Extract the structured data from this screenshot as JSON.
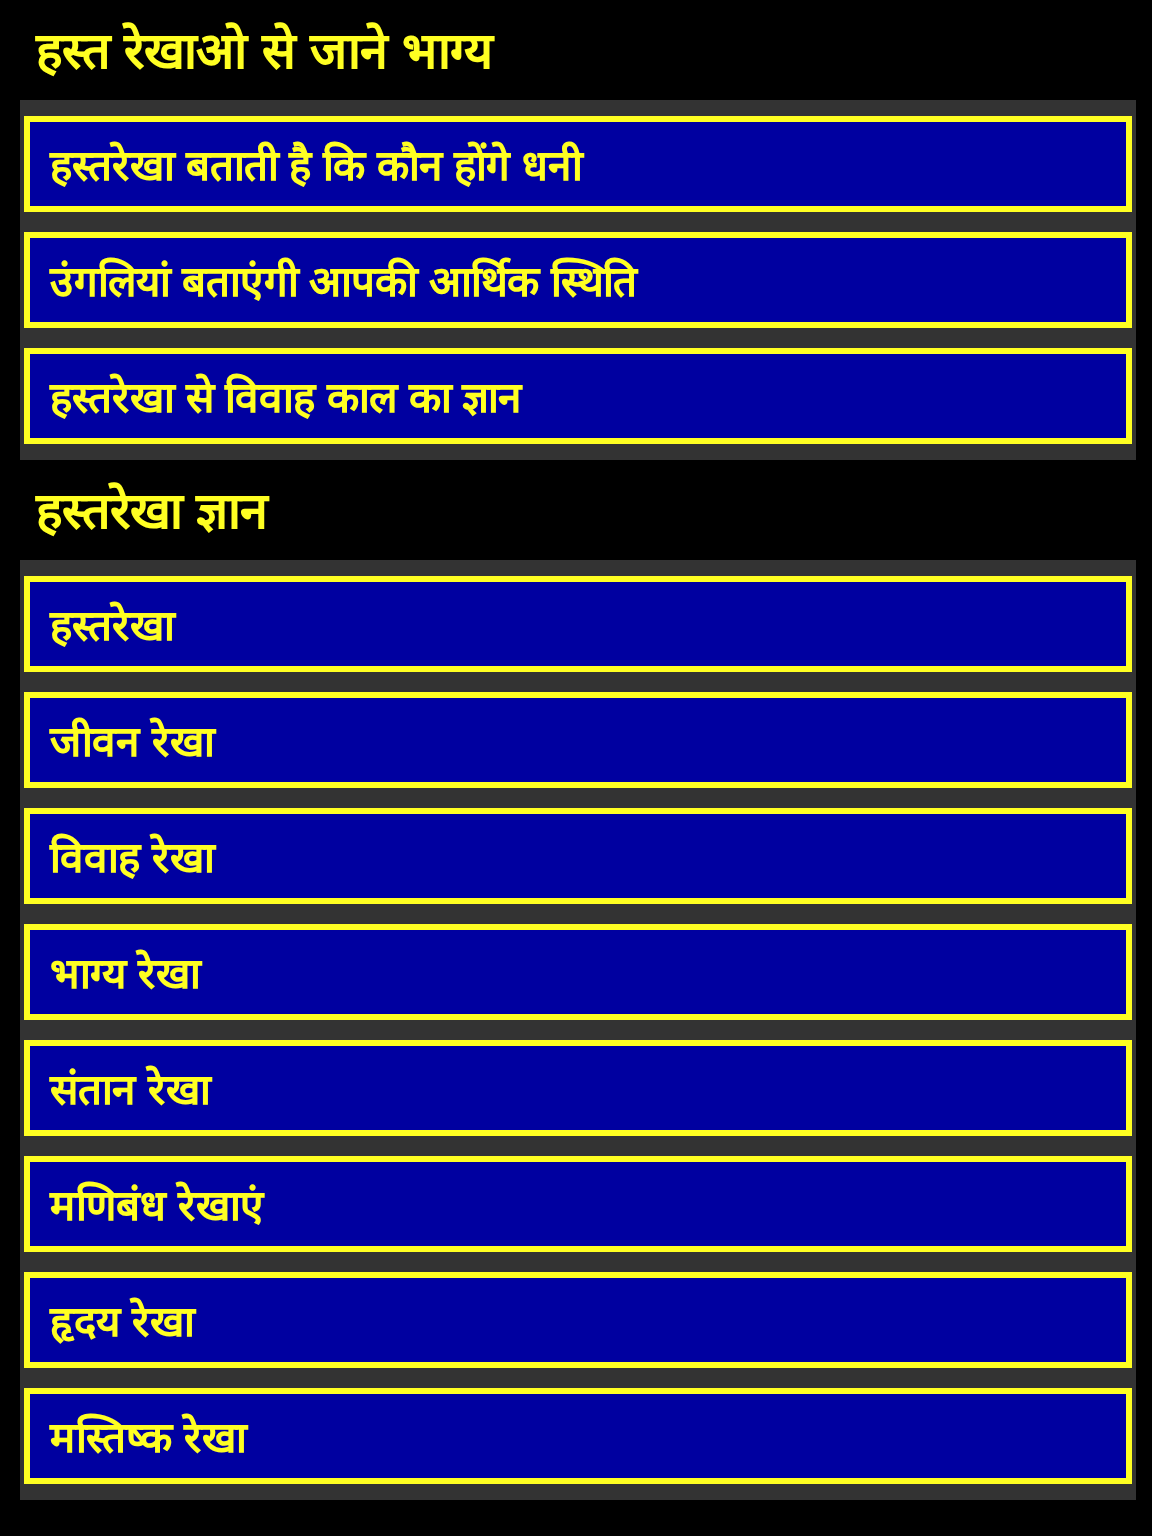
{
  "sections": [
    {
      "title": "हस्त रेखाओ से जाने भाग्य",
      "items": [
        {
          "label": "हस्तरेखा बताती है कि कौन होंगे धनी"
        },
        {
          "label": "उंगलियां बताएंगी आपकी आर्थिक स्थिति"
        },
        {
          "label": "हस्तरेखा से विवाह काल का ज्ञान"
        }
      ]
    },
    {
      "title": "हस्तरेखा ज्ञान",
      "items": [
        {
          "label": "हस्तरेखा"
        },
        {
          "label": "जीवन रेखा"
        },
        {
          "label": "विवाह रेखा"
        },
        {
          "label": "भाग्य रेखा"
        },
        {
          "label": "संतान रेखा"
        },
        {
          "label": "मणिबंध रेखाएं"
        },
        {
          "label": "हृदय रेखा"
        },
        {
          "label": "मस्तिष्क रेखा"
        }
      ]
    }
  ]
}
